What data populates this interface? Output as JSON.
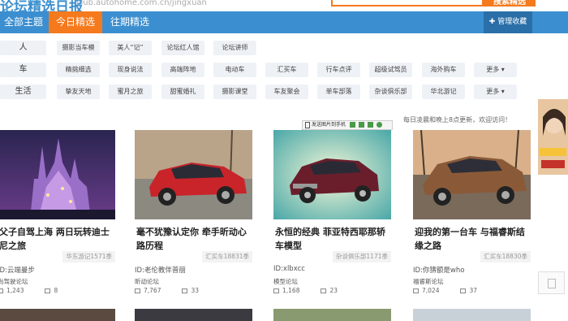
{
  "header": {
    "logo_text": "论坛精选日报",
    "logo_url": "club.autohome.com.cn/jingxuan",
    "search_button": "搜索精选"
  },
  "nav": {
    "tabs": [
      "全部主题",
      "今日精选",
      "往期精选"
    ],
    "active_index": 1,
    "manage": "管理收藏"
  },
  "categories": [
    {
      "label": "人",
      "tags": [
        "摄影当车模",
        "美人“记”",
        "论坛红人馆",
        "论坛讲师"
      ],
      "more": ""
    },
    {
      "label": "车",
      "tags": [
        "精挑细选",
        "现身说法",
        "高端阵地",
        "电动车",
        "汇买车",
        "行车点评",
        "超级试驾员",
        "海外购车"
      ],
      "more": "更多"
    },
    {
      "label": "生活",
      "tags": [
        "挚友天地",
        "蜜月之旅",
        "甜蜜婚礼",
        "摄影课堂",
        "车友聚会",
        "单车部落",
        "杂谈俱乐部",
        "华北游记"
      ],
      "more": "更多"
    }
  ],
  "notice": "每日凌晨和晚上8点更新，欢迎访问！",
  "image_toolbar": "发送图片到手机",
  "cards": [
    {
      "title": "父子自驾上海 两日玩转迪士尼之旅",
      "source": "华东游记1571季",
      "author": "ID:云端曼步",
      "forum": "尚驾驶论坛",
      "views": "1,243",
      "comments": "8"
    },
    {
      "title": "毫不犹豫认定你 牵手昕动心路历程",
      "source": "汇买车18831季",
      "author": "ID:老伦教伴普丽",
      "forum": "昕动论坛",
      "views": "7,767",
      "comments": "33"
    },
    {
      "title": "永恒的经典 菲亚特西耶那轿车模型",
      "source": "杂谈俱乐部1171季",
      "author": "ID:xlbxcc",
      "forum": "模型论坛",
      "views": "1,168",
      "comments": "23"
    },
    {
      "title": "迎我的第一台车 与福睿斯结缘之路",
      "source": "汇买车18830季",
      "author": "ID:你猜额是who",
      "forum": "福睿斯论坛",
      "views": "7,024",
      "comments": "37"
    }
  ],
  "colors": {
    "nav_blue": "#3b8fd0",
    "accent_orange": "#f57a1d"
  }
}
